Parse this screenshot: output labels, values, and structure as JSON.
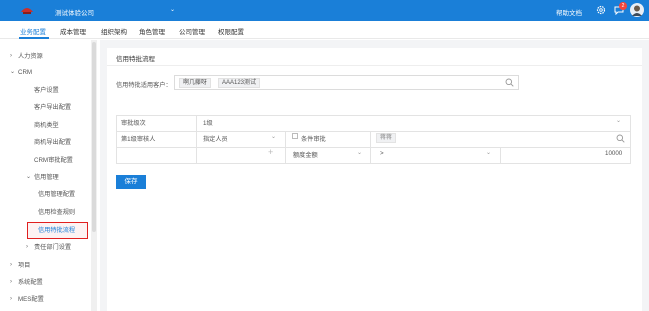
{
  "topbar": {
    "company": "测试体验公司",
    "help_label": "帮助文档",
    "badge_count": "2",
    "brand_color": "#1a7fd8"
  },
  "subnav": {
    "tabs": [
      {
        "label": "业务配置",
        "active": true
      },
      {
        "label": "成本管理",
        "active": false
      },
      {
        "label": "组织架构",
        "active": false
      },
      {
        "label": "角色管理",
        "active": false
      },
      {
        "label": "公司管理",
        "active": false
      },
      {
        "label": "权限配置",
        "active": false
      }
    ]
  },
  "sidebar": {
    "items": [
      {
        "label": "人力资源",
        "expanded": false,
        "level": 0
      },
      {
        "label": "CRM",
        "expanded": true,
        "level": 0
      },
      {
        "label": "客户设置",
        "level": 1
      },
      {
        "label": "客户导出配置",
        "level": 1
      },
      {
        "label": "商机类型",
        "level": 1
      },
      {
        "label": "商机导出配置",
        "level": 1
      },
      {
        "label": "CRM审批配置",
        "level": 1
      },
      {
        "label": "信用管理",
        "expanded": true,
        "level": 0
      },
      {
        "label": "信用管理配置",
        "level": 2
      },
      {
        "label": "信用检查规则",
        "level": 2
      },
      {
        "label": "信用特批流程",
        "level": 2,
        "active": true
      },
      {
        "label": "责任部门设置",
        "expanded": false,
        "level": 0
      },
      {
        "label": "项目",
        "expanded": false,
        "level": 0
      },
      {
        "label": "系统配置",
        "expanded": false,
        "level": 0
      },
      {
        "label": "MES配置",
        "expanded": false,
        "level": 0
      }
    ]
  },
  "main": {
    "title": "信用特批流程",
    "client_label": "信用特批适用客户：",
    "client_tags": [
      "啊几藤呀",
      "AAA123测试"
    ],
    "table": {
      "level_label": "审批级次",
      "level_value": "1级",
      "approver_label": "第1级审核人",
      "approver_type": "指定人员",
      "condition_label": "条件审批",
      "approver_placeholder": "蒋蒋",
      "field": "额度金额",
      "operator": ">",
      "amount": "10000"
    },
    "save_label": "保存"
  }
}
